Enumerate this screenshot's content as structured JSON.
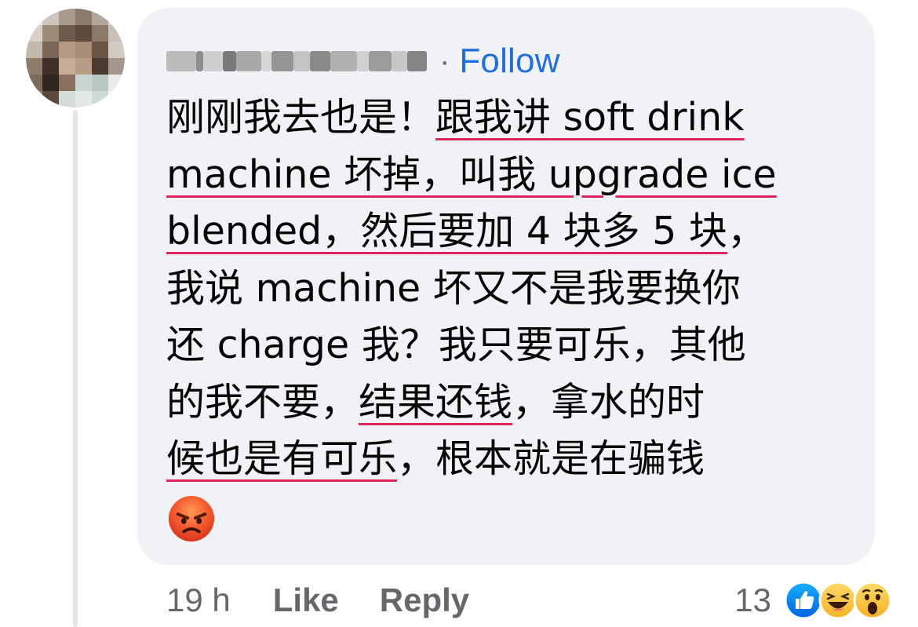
{
  "comment": {
    "author_name": "",
    "separator": "·",
    "follow_label": "Follow",
    "lines": [
      [
        {
          "text": "刚刚我去也是！",
          "underline": false
        },
        {
          "text": "跟我讲 soft drink",
          "underline": true
        }
      ],
      [
        {
          "text": "machine 坏掉，叫我 upgrade ice",
          "underline": true
        }
      ],
      [
        {
          "text": "blended，然后要加 4 块多 5 块",
          "underline": true
        },
        {
          "text": "，",
          "underline": false
        }
      ],
      [
        {
          "text": "我说 machine 坏又不是我要换你",
          "underline": false
        }
      ],
      [
        {
          "text": "还 charge 我？我只要可乐，其他",
          "underline": false
        }
      ],
      [
        {
          "text": "的我不要，",
          "underline": false
        },
        {
          "text": "结果还钱",
          "underline": true
        },
        {
          "text": "，拿水的时",
          "underline": false
        }
      ],
      [
        {
          "text": "候也是有可乐",
          "underline": true
        },
        {
          "text": "，根本就是在骗钱",
          "underline": false
        }
      ]
    ],
    "emoji": "angry-face"
  },
  "footer": {
    "time": "19 h",
    "like_label": "Like",
    "reply_label": "Reply"
  },
  "reactions": {
    "count": "13",
    "types": [
      "like",
      "haha",
      "wow"
    ]
  },
  "colors": {
    "bubble_bg": "#f0f2f5",
    "link_blue": "#216fdb",
    "muted_text": "#65676b",
    "underline_red": "#e0245e"
  }
}
